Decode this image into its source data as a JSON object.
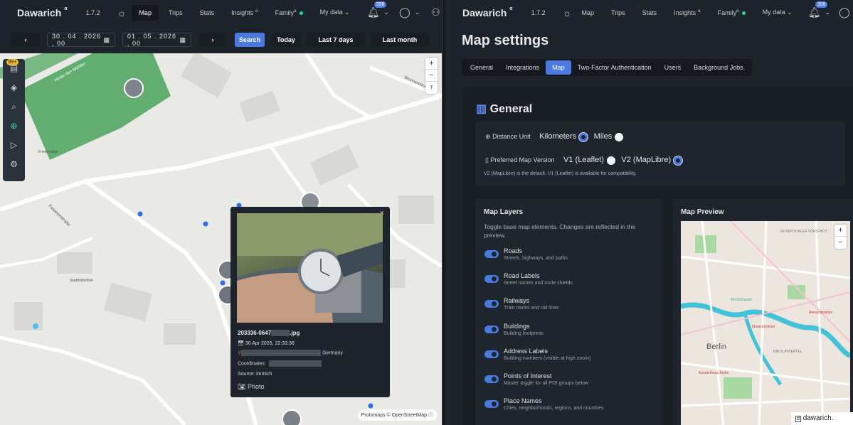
{
  "left_nav": {
    "brand": "Dawarich",
    "brand_sup": "α",
    "version": "1.7.2",
    "items": [
      "Map",
      "Trips",
      "Stats",
      "Insights",
      "Family"
    ],
    "insights_sup": "α",
    "family_sup": "α",
    "my_data": "My data",
    "notif_count": "356"
  },
  "toolbar": {
    "prev": "‹",
    "next": "›",
    "start_date": "30 . 04 . 2026 ,  00",
    "end_date": "01 . 05 . 2026 ,  00",
    "search": "Search",
    "today": "Today",
    "last7": "Last 7 days",
    "lastmonth": "Last month"
  },
  "map": {
    "sidebar_badge": "99+",
    "zoom_in": "+",
    "zoom_out": "−",
    "reset": "⤒",
    "street_labels": [
      "Hinter den Mühlen",
      "Fasanenstraße",
      "Friedenplatz",
      "Stadtbibliothek",
      "Brunnenstraße"
    ],
    "attribution": "Protomaps © OpenStreetMap",
    "popup": {
      "close": "×",
      "filename_prefix": "203336-0647",
      "filename_suffix": ".jpg",
      "date": "30 Apr 2026, 22:33:36",
      "country": "Germany",
      "coordinates_label": "Coordinates:",
      "source": "Source: immich",
      "type": "Photo"
    }
  },
  "right_nav": {
    "brand": "Dawarich",
    "brand_sup": "α",
    "version": "1.7.2",
    "items": [
      "Map",
      "Trips",
      "Stats",
      "Insights",
      "Family"
    ],
    "insights_sup": "α",
    "family_sup": "α",
    "my_data": "My data",
    "notif_count": "356"
  },
  "settings": {
    "title": "Map settings",
    "tabs": [
      "General",
      "Integrations",
      "Map",
      "Two-Factor Authentication",
      "Users",
      "Background Jobs"
    ],
    "active_tab": "Map",
    "section_title": "General",
    "distance_unit_label": "Distance Unit",
    "unit_km": "Kilometers",
    "unit_miles": "Miles",
    "map_version_label": "Preferred Map Version",
    "v1": "V1 (Leaflet)",
    "v2": "V2 (MapLibre)",
    "version_note": "V2 (MapLibre) is the default. V1 (Leaflet) is available for compatibility.",
    "layers_title": "Map Layers",
    "layers_desc": "Toggle base map elements. Changes are reflected in the preview.",
    "layers": [
      {
        "title": "Roads",
        "desc": "Streets, highways, and paths"
      },
      {
        "title": "Road Labels",
        "desc": "Street names and route shields"
      },
      {
        "title": "Railways",
        "desc": "Train tracks and rail lines"
      },
      {
        "title": "Buildings",
        "desc": "Building footprints"
      },
      {
        "title": "Address Labels",
        "desc": "Building numbers (visible at high zoom)"
      },
      {
        "title": "Points of Interest",
        "desc": "Master toggle for all POI groups below"
      },
      {
        "title": "Place Names",
        "desc": "Cities, neighborhoods, regions, and countries"
      }
    ],
    "preview_title": "Map Preview",
    "preview_labels": [
      "Berlin",
      "Alexanderplatz",
      "Museumsinsel",
      "NIKOLAIVIERTEL",
      "Monbijoupark",
      "Konzerthaus Berlin",
      "ROSENTHALER VORSTADT"
    ],
    "zoom_in": "+",
    "zoom_out": "−",
    "footer_tag": "dawarich."
  },
  "colors": {
    "accent": "#4a7ae0",
    "online": "#36d399",
    "park": "#49a35b"
  }
}
